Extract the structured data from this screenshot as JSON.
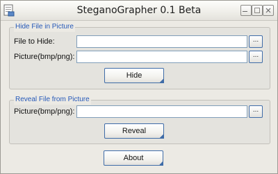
{
  "window": {
    "title": "SteganoGrapher 0.1 Beta"
  },
  "icons": {
    "app": "document-icon",
    "minimize": "minimize-icon",
    "maximize": "maximize-icon",
    "close": "close-icon"
  },
  "hide_group": {
    "title": "Hide File in Picture",
    "file_label": "File to Hide:",
    "file_value": "",
    "picture_label": "Picture(bmp/png):",
    "picture_value": "",
    "browse_label": "...",
    "button_label": "Hide"
  },
  "reveal_group": {
    "title": "Reveal File from Picture",
    "picture_label": "Picture(bmp/png):",
    "picture_value": "",
    "browse_label": "...",
    "button_label": "Reveal"
  },
  "about_label": "About",
  "colors": {
    "group_title": "#2558b8",
    "input_border": "#7f9db9",
    "button_border": "#3f6ca8"
  }
}
